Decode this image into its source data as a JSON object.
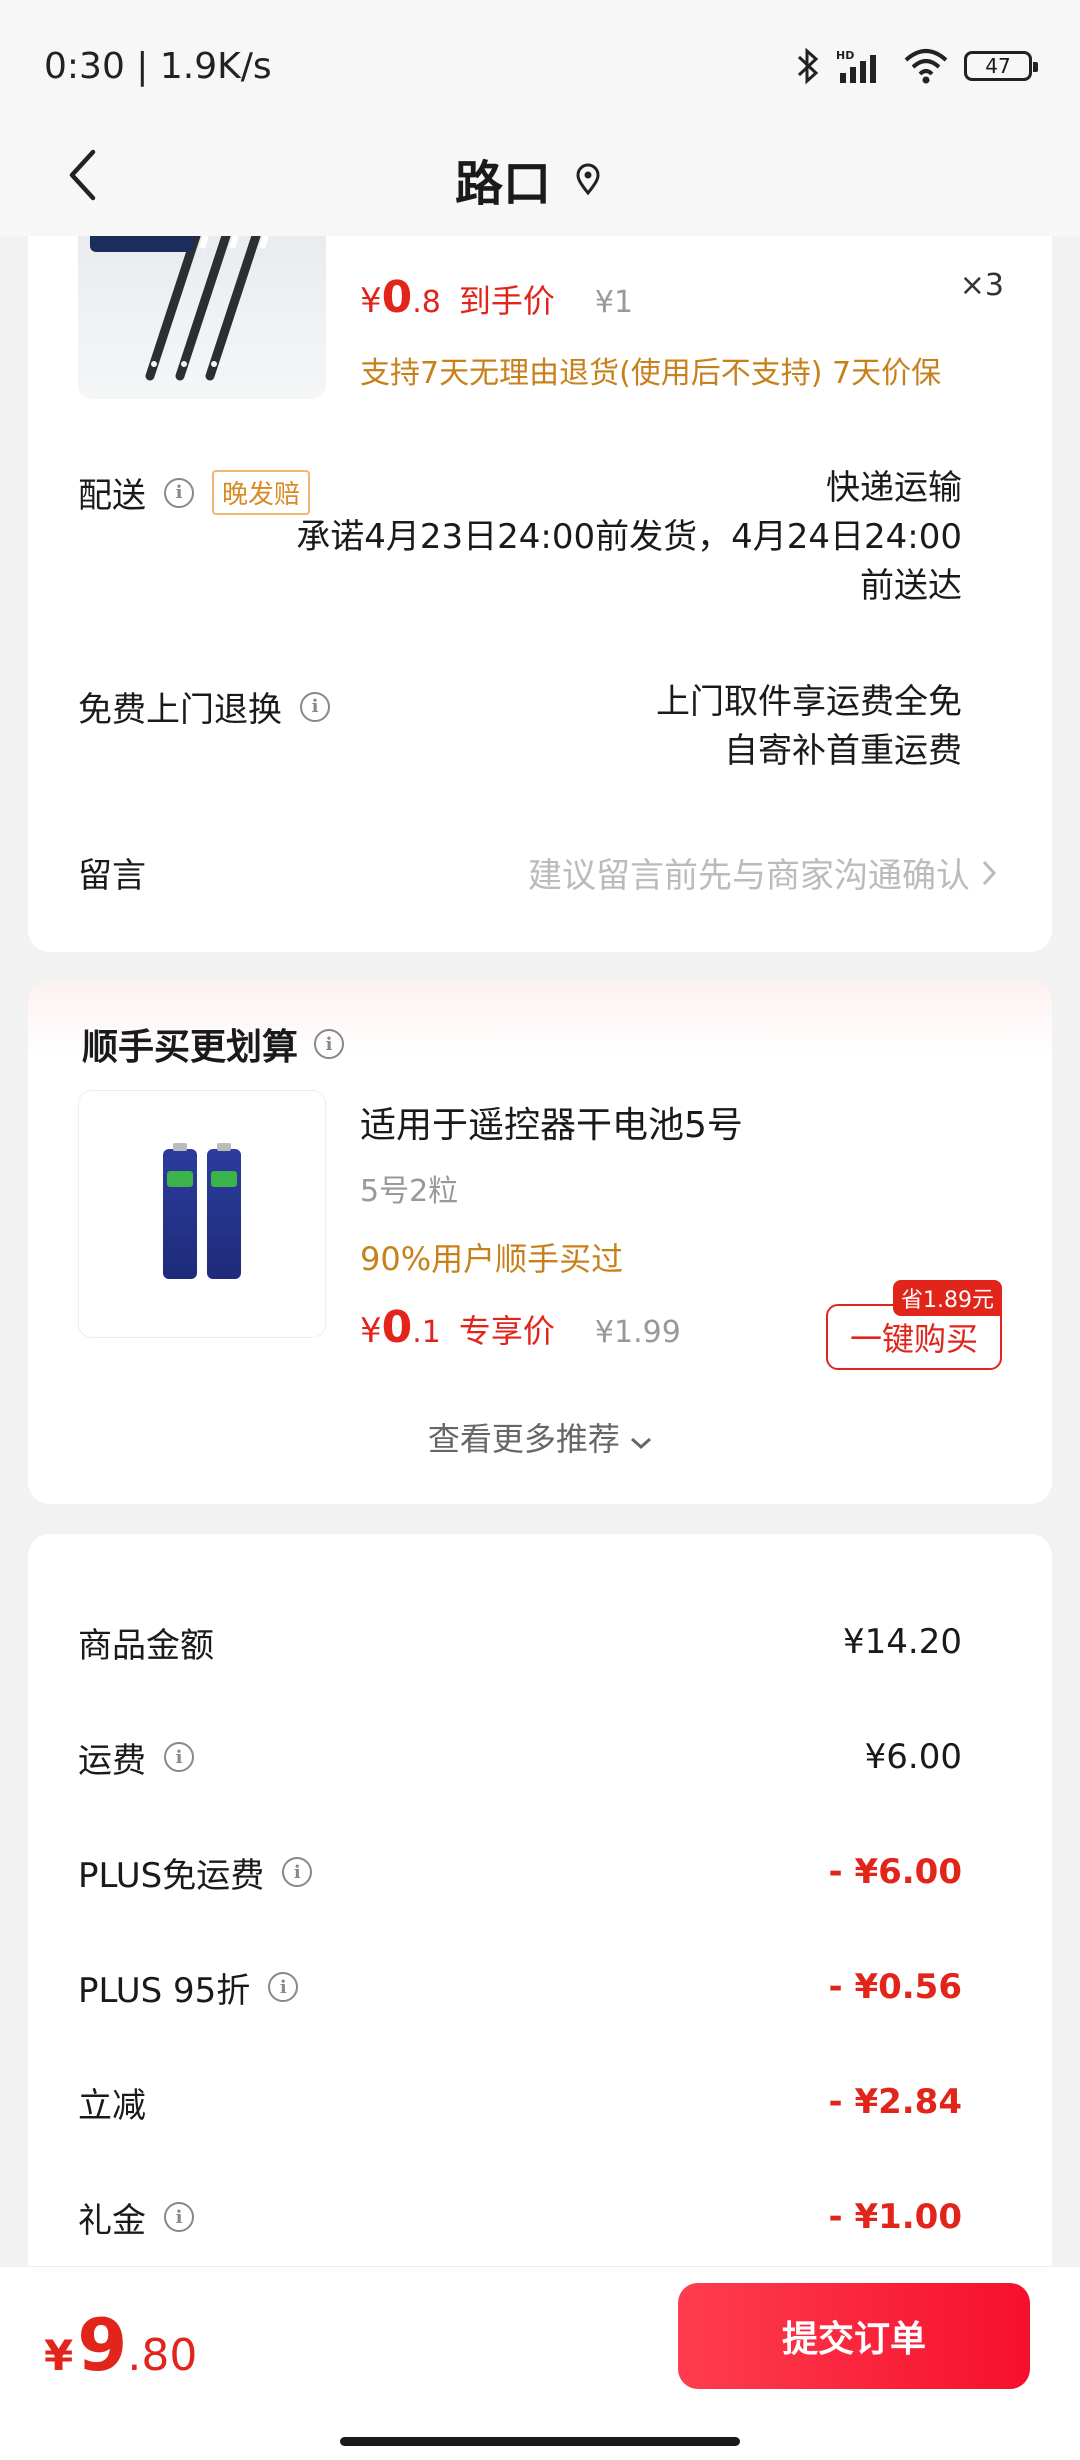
{
  "status": {
    "time": "0:30 | 1.9K/s",
    "battery": "47",
    "icons": [
      "bluetooth-icon",
      "hd-signal-icon",
      "wifi-icon",
      "battery-icon"
    ]
  },
  "nav": {
    "title": "路口",
    "icons": [
      "back-icon",
      "location-pin-icon"
    ]
  },
  "item": {
    "price_symbol": "¥",
    "price_int": "0",
    "price_dec": ".8",
    "price_tag": "到手价",
    "original_price": "¥1",
    "quantity": "×3",
    "policy": "支持7天无理由退货(使用后不支持) 7天价保"
  },
  "delivery": {
    "label": "配送",
    "badge": "晚发赔",
    "method": "快递运输",
    "promise_line1": "承诺4月23日24:00前发货，4月24日24:00",
    "promise_line2": "前送达"
  },
  "return": {
    "label": "免费上门退换",
    "line1": "上门取件享运费全免",
    "line2": "自寄补首重运费"
  },
  "message": {
    "label": "留言",
    "placeholder": "建议留言前先与商家沟通确认"
  },
  "addon": {
    "title": "顺手买更划算",
    "product_name": "适用于遥控器干电池5号",
    "spec": "5号2粒",
    "social": "90%用户顺手买过",
    "price_symbol": "¥",
    "price_int": "0",
    "price_dec": ".1",
    "price_tag": "专享价",
    "original_price": "¥1.99",
    "save_badge": "省1.89元",
    "buy_button": "一键购买",
    "more": "查看更多推荐"
  },
  "fees": [
    {
      "label": "商品金额",
      "value": "¥14.20",
      "negative": false,
      "info": false
    },
    {
      "label": "运费",
      "value": "¥6.00",
      "negative": false,
      "info": true
    },
    {
      "label": "PLUS免运费",
      "value": "- ¥6.00",
      "negative": true,
      "info": true
    },
    {
      "label": "PLUS 95折",
      "value": "- ¥0.56",
      "negative": true,
      "info": true
    },
    {
      "label": "立减",
      "value": "- ¥2.84",
      "negative": true,
      "info": false
    },
    {
      "label": "礼金",
      "value": "- ¥1.00",
      "negative": true,
      "info": true
    }
  ],
  "bottom": {
    "total_symbol": "¥",
    "total_int": "9",
    "total_dec": ".80",
    "submit": "提交订单"
  },
  "colors": {
    "accent_red": "#e1251b",
    "policy_orange": "#c8801c",
    "hint_gray": "#bbbbbb"
  }
}
